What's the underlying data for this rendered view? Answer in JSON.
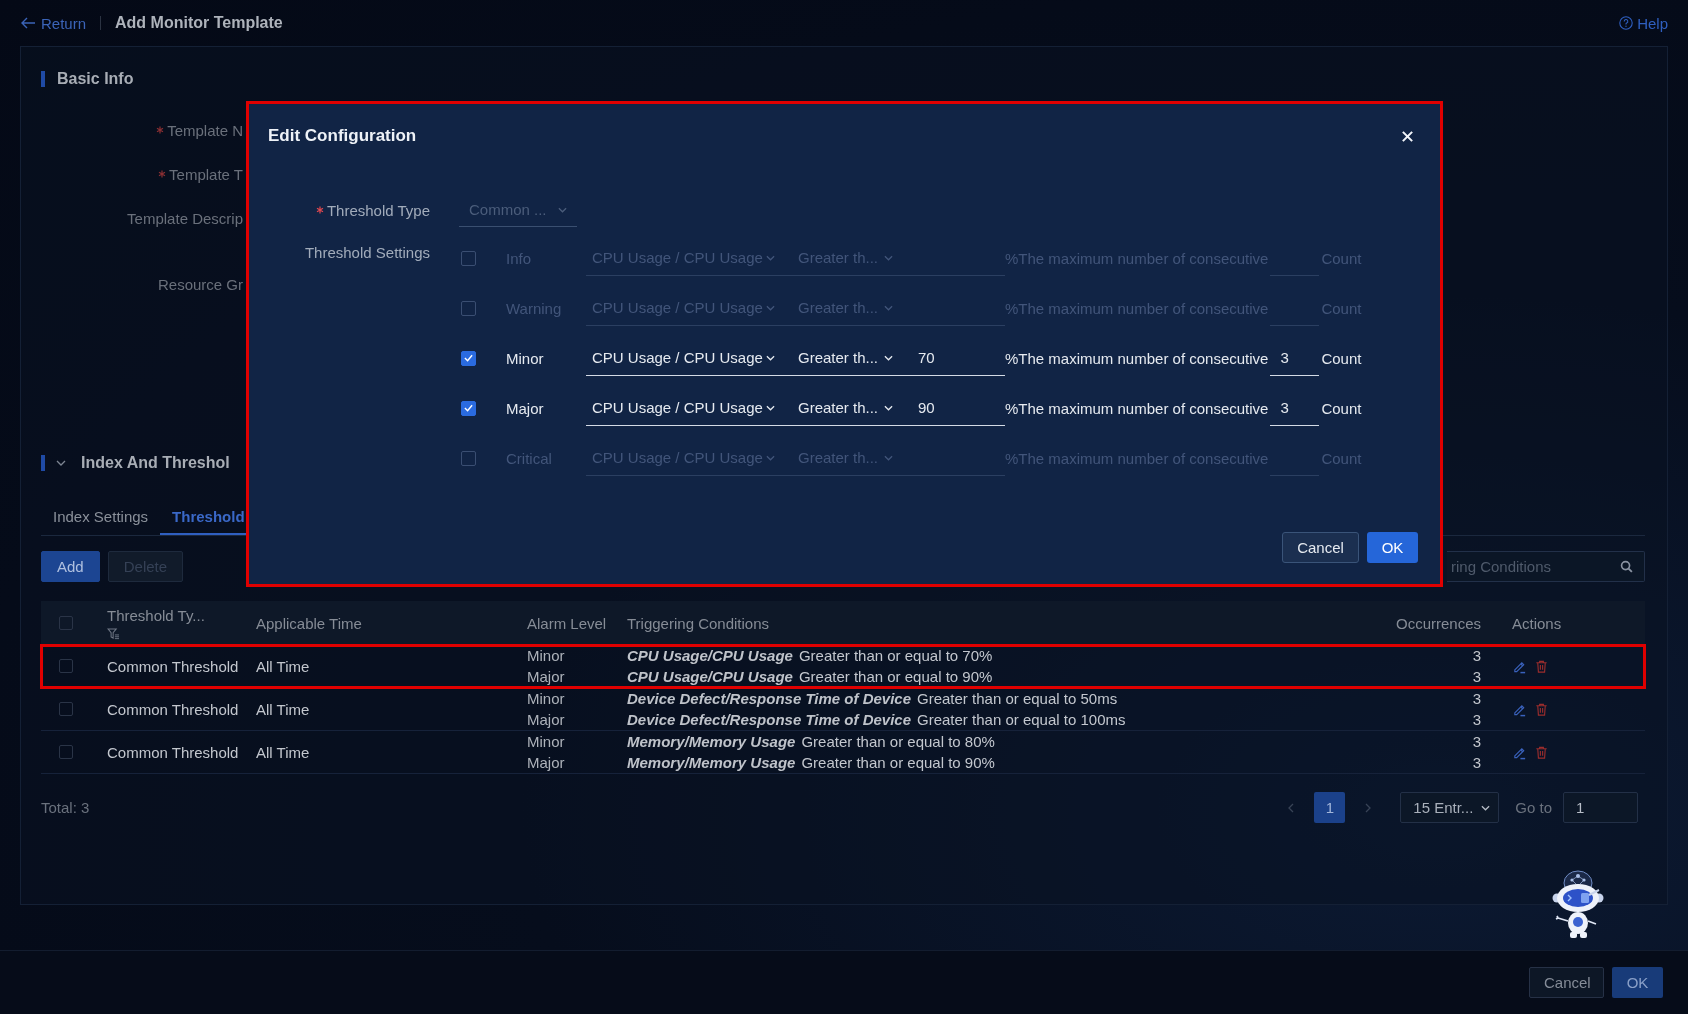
{
  "header": {
    "back_link": "Return",
    "title": "Add Monitor Template",
    "help_link": "Help"
  },
  "basic_info": {
    "heading": "Basic Info",
    "fields": [
      {
        "label": "Template N",
        "required": true,
        "kind": "line"
      },
      {
        "label": "Template T",
        "required": true,
        "kind": "line"
      },
      {
        "label": "Template Descrip",
        "required": false,
        "kind": "textarea"
      },
      {
        "label": "Resource Gr",
        "required": false,
        "kind": "line"
      }
    ]
  },
  "index_section": {
    "heading": "Index And Threshol",
    "expanded": true,
    "tabs": [
      {
        "label": "Index Settings",
        "selected": false
      },
      {
        "label": "Threshold",
        "selected": true
      }
    ],
    "buttons": [
      {
        "label": "Add",
        "disabled": false
      },
      {
        "label": "Delete",
        "disabled": true
      }
    ],
    "search": {
      "placeholder": "ring Conditions"
    },
    "table": {
      "all_checked": false,
      "columns": [
        {
          "label": "Threshold Ty...",
          "filter": true
        },
        {
          "label": "Applicable Time",
          "filter": false
        },
        {
          "label": "Alarm Level",
          "filter": false
        },
        {
          "label": "Triggering Conditions",
          "filter": false
        },
        {
          "label": "Occurrences",
          "filter": false
        },
        {
          "label": "Actions",
          "filter": false
        }
      ],
      "rows": [
        {
          "checked": false,
          "highlighted": true,
          "threshold_type": "Common Threshold",
          "applicable_time": "All Time",
          "alarms": [
            {
              "level": "Minor",
              "metric": "CPU Usage/CPU Usage",
              "condition": "Greater than or equal to 70%",
              "occurrences": "3"
            },
            {
              "level": "Major",
              "metric": "CPU Usage/CPU Usage",
              "condition": "Greater than or equal to 90%",
              "occurrences": "3"
            }
          ]
        },
        {
          "checked": false,
          "highlighted": false,
          "threshold_type": "Common Threshold",
          "applicable_time": "All Time",
          "alarms": [
            {
              "level": "Minor",
              "metric": "Device Defect/Response Time of Device",
              "condition": "Greater than or equal to 50ms",
              "occurrences": "3"
            },
            {
              "level": "Major",
              "metric": "Device Defect/Response Time of Device",
              "condition": "Greater than or equal to 100ms",
              "occurrences": "3"
            }
          ]
        },
        {
          "checked": false,
          "highlighted": false,
          "threshold_type": "Common Threshold",
          "applicable_time": "All Time",
          "alarms": [
            {
              "level": "Minor",
              "metric": "Memory/Memory Usage",
              "condition": "Greater than or equal to 80%",
              "occurrences": "3"
            },
            {
              "level": "Major",
              "metric": "Memory/Memory Usage",
              "condition": "Greater than or equal to 90%",
              "occurrences": "3"
            }
          ]
        }
      ]
    },
    "total": "Total: 3",
    "pagination": {
      "pages": [
        {
          "label": "1",
          "selected": true
        }
      ],
      "page_size": "15 Entr...",
      "goto_label": "Go to",
      "goto_value": "1"
    }
  },
  "footer": {
    "buttons": [
      {
        "label": "Cancel",
        "kind": "secondary"
      },
      {
        "label": "OK",
        "kind": "primary"
      }
    ]
  },
  "dialog": {
    "title": "Edit Configuration",
    "highlighted": true,
    "threshold_type": {
      "label": "Threshold Type",
      "required": true,
      "value": "Common ...",
      "disabled": true
    },
    "settings_label": "Threshold Settings",
    "levels": [
      {
        "checked": false,
        "label": "Info",
        "metric": "CPU Usage / CPU Usage",
        "operator": "Greater th...",
        "suffix": "%The maximum number of consecutive",
        "unit": "Count"
      },
      {
        "checked": false,
        "label": "Warning",
        "metric": "CPU Usage / CPU Usage",
        "operator": "Greater th...",
        "suffix": "%The maximum number of consecutive",
        "unit": "Count"
      },
      {
        "checked": true,
        "label": "Minor",
        "metric": "CPU Usage / CPU Usage",
        "operator": "Greater th...",
        "value": "70",
        "suffix": "%The maximum number of consecutive",
        "count": "3",
        "unit": "Count"
      },
      {
        "checked": true,
        "label": "Major",
        "metric": "CPU Usage / CPU Usage",
        "operator": "Greater th...",
        "value": "90",
        "suffix": "%The maximum number of consecutive",
        "count": "3",
        "unit": "Count"
      },
      {
        "checked": false,
        "label": "Critical",
        "metric": "CPU Usage / CPU Usage",
        "operator": "Greater th...",
        "suffix": "%The maximum number of consecutive",
        "unit": "Count"
      }
    ],
    "buttons": [
      {
        "label": "Cancel",
        "kind": "secondary"
      },
      {
        "label": "OK",
        "kind": "primary"
      }
    ]
  }
}
